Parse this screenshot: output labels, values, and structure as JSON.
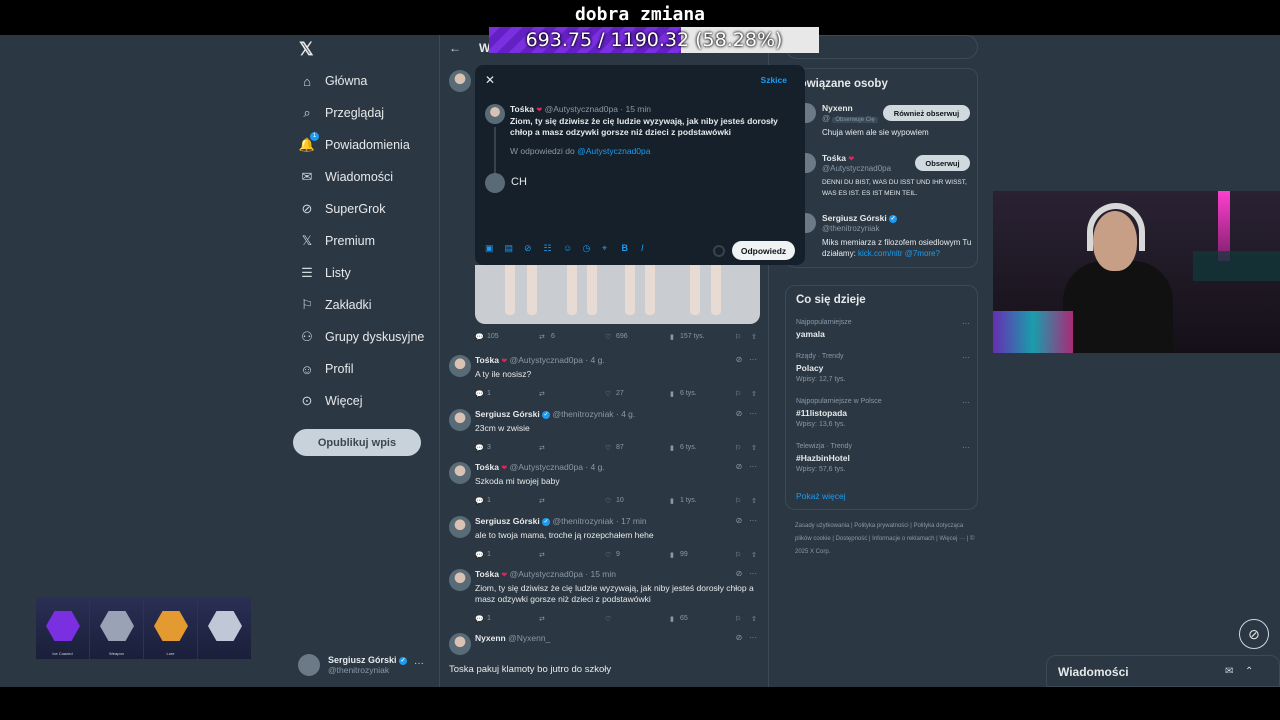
{
  "overlay": {
    "title": "dobra zmiana",
    "goal_text": "693.75 / 1190.32 (58.28%)",
    "goal_progress": 0.5828
  },
  "nav": {
    "items": [
      {
        "icon": "home-icon",
        "glyph": "⌂",
        "label": "Główna"
      },
      {
        "icon": "search-icon",
        "glyph": "⌕",
        "label": "Przeglądaj"
      },
      {
        "icon": "bell-icon",
        "glyph": "🔔",
        "label": "Powiadomienia"
      },
      {
        "icon": "mail-icon",
        "glyph": "✉",
        "label": "Wiadomości"
      },
      {
        "icon": "grok-icon",
        "glyph": "⊘",
        "label": "SuperGrok"
      },
      {
        "icon": "x-icon",
        "glyph": "𝕏",
        "label": "Premium"
      },
      {
        "icon": "list-icon",
        "glyph": "☰",
        "label": "Listy"
      },
      {
        "icon": "bookmark-icon",
        "glyph": "⚐",
        "label": "Zakładki"
      },
      {
        "icon": "communities-icon",
        "glyph": "⚇",
        "label": "Grupy dyskusyjne"
      },
      {
        "icon": "profile-icon",
        "glyph": "☺",
        "label": "Profil"
      },
      {
        "icon": "more-icon",
        "glyph": "⊙",
        "label": "Więcej"
      }
    ],
    "notif_count": "1",
    "post_button": "Opublikuj wpis",
    "account_name": "Sergiusz Górski",
    "account_handle": "@thenitrozyniak"
  },
  "main": {
    "header": "W",
    "top_actions": {
      "replies": "105",
      "reposts": "6",
      "likes": "696",
      "views": "157 tys."
    },
    "replies": [
      {
        "name": "Tośka",
        "handle": "@Autystycznad0pa · 4 g.",
        "text": "A ty ile nosisz?",
        "stats": {
          "replies": "1",
          "reposts": "",
          "likes": "27",
          "views": "6 tys."
        }
      },
      {
        "name": "Sergiusz Górski",
        "handle": "@thenitrozyniak · 4 g.",
        "text": "23cm w zwisie",
        "stats": {
          "replies": "3",
          "reposts": "",
          "likes": "87",
          "views": "6 tys."
        }
      },
      {
        "name": "Tośka",
        "handle": "@Autystycznad0pa · 4 g.",
        "text": "Szkoda mi twojej baby",
        "stats": {
          "replies": "1",
          "reposts": "",
          "likes": "10",
          "views": "1 tys."
        }
      },
      {
        "name": "Sergiusz Górski",
        "handle": "@thenitrozyniak · 17 min",
        "text": "ale to twoja mama, troche ją rozepchałem hehe",
        "stats": {
          "replies": "1",
          "reposts": "",
          "likes": "9",
          "views": "99"
        }
      },
      {
        "name": "Tośka",
        "handle": "@Autystycznad0pa · 15 min",
        "text": "Ziom, ty się dziwisz że cię ludzie wyzywają, jak niby jesteś dorosły chłop a masz odzywki gorsze niż dzieci z podstawówki",
        "stats": {
          "replies": "1",
          "reposts": "",
          "likes": "",
          "views": "65"
        }
      },
      {
        "name": "Nyxenn",
        "handle": "@Nyxenn_",
        "text": "",
        "stats": null
      }
    ],
    "bottom_text": "Toska pakuj klamoty bo jutro do szkoły"
  },
  "modal": {
    "drafts": "Szkice",
    "quoted_name": "Tośka",
    "quoted_handle": "@Autystycznad0pa · 15 min",
    "quoted_text": "Ziom, ty się dziwisz że cię ludzie wyzywają, jak niby jesteś dorosły chłop a masz odzywki gorsze niż dzieci z podstawówki",
    "reply_to_prefix": "W odpowiedzi do",
    "reply_to_handle": "@Autystycznad0pa",
    "compose_value": "CH",
    "toolbar_icons": [
      "image-icon",
      "gif-icon",
      "grok-icon",
      "poll-icon",
      "emoji-icon",
      "schedule-icon",
      "location-icon",
      "bold-icon",
      "italic-icon"
    ],
    "toolbar_glyphs": [
      "▣",
      "▤",
      "⊘",
      "☷",
      "☺",
      "◷",
      "⌖",
      "B",
      "I"
    ],
    "reply_button": "Odpowiedz"
  },
  "right": {
    "related_title": "Powiązane osoby",
    "people": [
      {
        "name": "Nyxenn",
        "handle": "@",
        "follows_you": "Obserwuje Cię",
        "bio": "Chuja wiem ale sie wypowiem",
        "button": "Również obserwuj"
      },
      {
        "name": "Tośka",
        "handle": "@Autystycznad0pa",
        "bio": "DENNI DU BIST, WAS DU ISST UND IHR WISST, WAS ES IST. ES IST MEIN TEIL.",
        "button": "Obserwuj"
      },
      {
        "name": "Sergiusz Górski",
        "handle": "@thenitrozyniak",
        "bio": "Miks memiarza z filozofem osiedlowym Tu działamy:",
        "bio_link": "kick.com/nitr @7more?",
        "button": ""
      }
    ],
    "trending_title": "Co się dzieje",
    "trends": [
      {
        "context": "Najpopularniejsze",
        "name": "yamala",
        "posts": ""
      },
      {
        "context": "Rządy · Trendy",
        "name": "Polacy",
        "posts": "Wpisy: 12,7 tys."
      },
      {
        "context": "Najpopularniejsze w Polsce",
        "name": "#11listopada",
        "posts": "Wpisy: 13,6 tys."
      },
      {
        "context": "Telewizja · Trendy",
        "name": "#HazbinHotel",
        "posts": "Wpisy: 57,6 tys."
      }
    ],
    "show_more": "Pokaż więcej",
    "footer": "Zasady użytkowania | Polityka prywatności | Polityka dotycząca plików cookie | Dostępność | Informacje o reklamach | Więcej ··· | © 2025 X Corp."
  },
  "game_strip": {
    "labels": [
      "Ice Coaxed",
      "Weapon",
      "Lore",
      ""
    ]
  },
  "messages_bar": {
    "title": "Wiadomości"
  }
}
